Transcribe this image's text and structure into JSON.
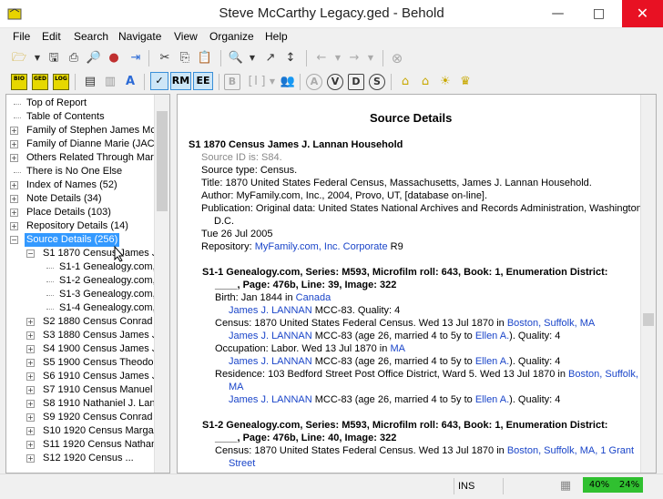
{
  "window": {
    "title": "Steve McCarthy Legacy.ged - Behold",
    "minimize": "—",
    "maximize": "□",
    "close": "✕"
  },
  "menu": [
    "File",
    "Edit",
    "Search",
    "Navigate",
    "View",
    "Organize",
    "Help"
  ],
  "toolbar2_toggles": {
    "check": "✓",
    "rm": "RM",
    "ee": "EE"
  },
  "toolbar2_letters": {
    "b": "B",
    "i": "I",
    "a": "A",
    "v": "V",
    "d": "D",
    "s": "S"
  },
  "tree": [
    {
      "label": "Top of Report",
      "expander": ""
    },
    {
      "label": "Table of Contents",
      "expander": ""
    },
    {
      "label": "Family of Stephen James McC",
      "expander": "+"
    },
    {
      "label": "Family of Dianne Marie (JACK",
      "expander": "+"
    },
    {
      "label": "Others Related Through Marr",
      "expander": "+"
    },
    {
      "label": "There is No One Else",
      "expander": ""
    },
    {
      "label": "Index of Names (52)",
      "expander": "+"
    },
    {
      "label": "Note Details (34)",
      "expander": "+"
    },
    {
      "label": "Place Details (103)",
      "expander": "+"
    },
    {
      "label": "Repository Details (14)",
      "expander": "+"
    },
    {
      "label": "Source Details (256)",
      "expander": "−",
      "selected": true
    },
    {
      "label": "S1 1870 Census James J",
      "expander": "−"
    },
    {
      "label": "S1-1 Genealogy.com,",
      "expander": ""
    },
    {
      "label": "S1-2 Genealogy.com,",
      "expander": ""
    },
    {
      "label": "S1-3 Genealogy.com,",
      "expander": ""
    },
    {
      "label": "S1-4 Genealogy.com,",
      "expander": ""
    },
    {
      "label": "S2 1880 Census Conrad",
      "expander": "+"
    },
    {
      "label": "S3 1880 Census James J",
      "expander": "+"
    },
    {
      "label": "S4 1900 Census James J",
      "expander": "+"
    },
    {
      "label": "S5 1900 Census Theodor",
      "expander": "+"
    },
    {
      "label": "S6 1910 Census James J",
      "expander": "+"
    },
    {
      "label": "S7 1910 Census Manuel S",
      "expander": "+"
    },
    {
      "label": "S8 1910 Nathaniel J. Lann",
      "expander": "+"
    },
    {
      "label": "S9 1920 Census Conrad J",
      "expander": "+"
    },
    {
      "label": "S10 1920 Census Margar",
      "expander": "+"
    },
    {
      "label": "S11 1920 Census Nathan",
      "expander": "+"
    },
    {
      "label": "S12 1920 Census ...",
      "expander": "+"
    }
  ],
  "content": {
    "heading": "Source Details",
    "s1_title": "S1  1870 Census James J. Lannan Household",
    "source_id": "Source ID is: S84.",
    "source_type": "Source type: Census.",
    "title_line": "Title: 1870 United States Federal Census, Massachusetts, James J. Lannan Household.",
    "author": "Author: MyFamily.com, Inc., 2004, Provo, UT, [database on-line].",
    "publication": "Publication: Original data: United States National Archives and Records Administration, Washington",
    "publication_cont": "D.C.",
    "date": "Tue 26 Jul 2005",
    "repo_prefix": "Repository: ",
    "repo_link": "MyFamily.com, Inc. Corporate",
    "repo_suffix": " R9",
    "s1_1_title": "S1-1  Genealogy.com, Series: M593, Microfilm roll: 643, Book: 1, Enumeration District:",
    "s1_1_title_cont": "____, Page: 476b, Line: 39, Image: 322",
    "birth_prefix": "Birth: Jan 1844 in ",
    "birth_place": "Canada",
    "birth_person": "James J. LANNAN",
    "birth_suffix": " MCC-83. Quality: 4",
    "census_prefix": "Census: 1870 United States Federal Census. Wed 13 Jul 1870 in ",
    "census_place": "Boston, Suffolk, MA",
    "census_person": "James J. LANNAN",
    "census_mid": " MCC-83 (age 26, married 4 to 5y to ",
    "census_spouse": "Ellen A.",
    "census_suffix": "). Quality: 4",
    "occ_prefix": "Occupation: Labor. Wed 13 Jul 1870 in ",
    "occ_place": "MA",
    "occ_person": "James J. LANNAN",
    "occ_mid": " MCC-83 (age 26, married 4 to 5y to ",
    "occ_spouse": "Ellen A.",
    "occ_suffix": "). Quality: 4",
    "res_prefix": "Residence: 103 Bedford Street Post Office District, Ward 5. Wed 13 Jul 1870 in ",
    "res_place": "Boston, Suffolk,",
    "res_place_cont": "MA",
    "res_person": "James J. LANNAN",
    "res_mid": " MCC-83 (age 26, married 4 to 5y to ",
    "res_spouse": "Ellen A.",
    "res_suffix": "). Quality: 4",
    "s1_2_title": "S1-2  Genealogy.com, Series: M593, Microfilm roll: 643, Book: 1, Enumeration District:",
    "s1_2_title_cont": "____, Page: 476b, Line: 40, Image: 322",
    "census2_prefix": "Census: 1870 United States Federal Census. Wed 13 Jul 1870 in ",
    "census2_place": "Boston, Suffolk, MA, 1 Grant",
    "census2_place_cont": "Street"
  },
  "status": {
    "ins": "INS",
    "pct1": "40%",
    "pct2": "24%"
  }
}
